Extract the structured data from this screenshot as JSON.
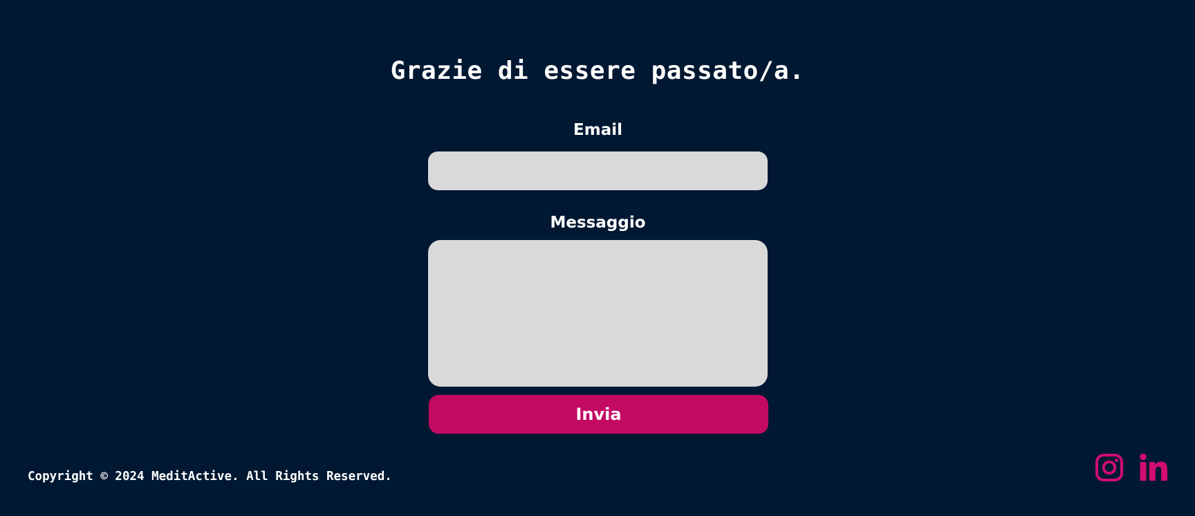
{
  "heading": "Grazie di essere passato/a.",
  "form": {
    "email_label": "Email",
    "email_value": "",
    "message_label": "Messaggio",
    "message_value": "",
    "submit_label": "Invia"
  },
  "footer": {
    "copyright": "Copyright © 2024 MeditActive. All Rights Reserved.",
    "social": [
      {
        "icon": "instagram-icon"
      },
      {
        "icon": "linkedin-icon"
      }
    ]
  },
  "colors": {
    "background": "#001832",
    "accent": "#c30a63",
    "icon": "#d10d6f",
    "field_background": "#d9d9da",
    "text": "#ffffff"
  }
}
